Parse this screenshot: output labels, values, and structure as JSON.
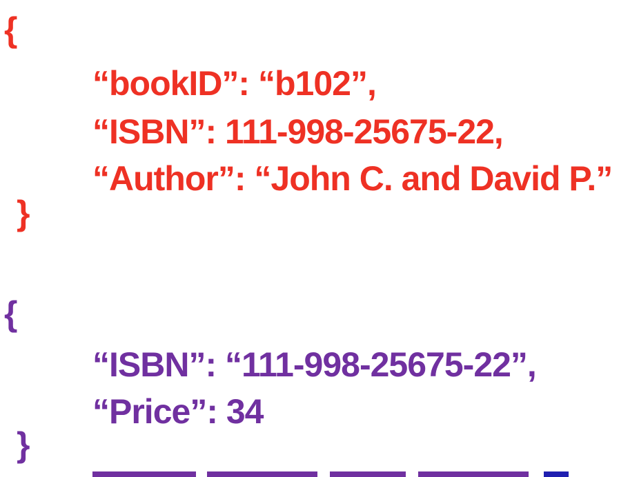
{
  "colors": {
    "first_object": "#ee3124",
    "second_object": "#7030a0",
    "cut_line_primary": "#7030a0",
    "cut_line_accent": "#1f1fb0"
  },
  "object1": {
    "open_brace": "{",
    "lines": [
      "“bookID”: “b102”,",
      "“ISBN”: 111-998-25675-22,",
      "“Author”: “John C. and David P.”"
    ],
    "close_brace": "}"
  },
  "object2": {
    "open_brace": "{",
    "lines": [
      "“ISBN”: “111-998-25675-22”,",
      "“Price”: 34"
    ],
    "close_brace": "}"
  }
}
